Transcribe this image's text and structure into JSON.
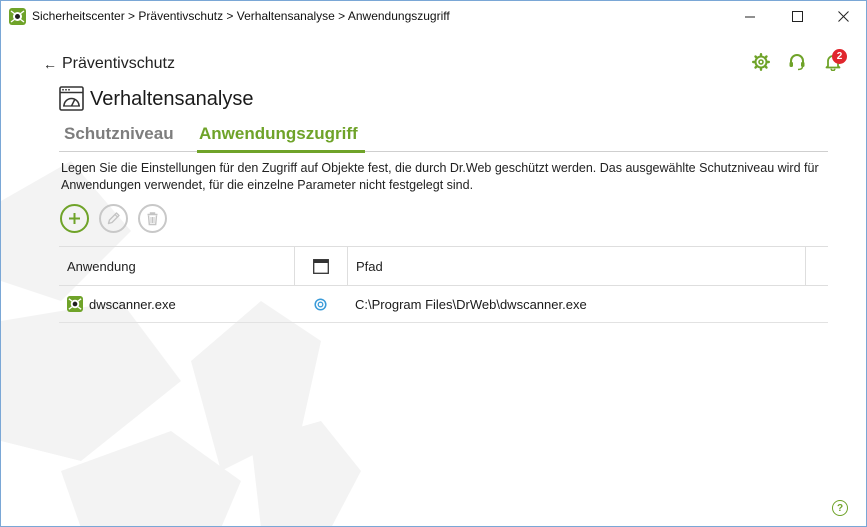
{
  "window": {
    "breadcrumb": "Sicherheitscenter > Präventivschutz > Verhaltensanalyse > Anwendungszugriff",
    "controls": {
      "minimize": "minimize-icon",
      "maximize": "maximize-icon",
      "close": "close-icon"
    }
  },
  "header": {
    "back_label": "Präventivschutz",
    "notification_count": "2",
    "icons": [
      "gear-icon",
      "headset-icon",
      "bell-icon"
    ]
  },
  "section": {
    "title": "Verhaltensanalyse"
  },
  "tabs": [
    {
      "label": "Schutzniveau",
      "active": false
    },
    {
      "label": "Anwendungszugriff",
      "active": true
    }
  ],
  "description": "Legen Sie die Einstellungen für den Zugriff auf Objekte fest, die durch Dr.Web geschützt werden. Das ausgewählte Schutzniveau wird für Anwendungen verwendet, für die einzelne Parameter nicht festgelegt sind.",
  "toolbar": {
    "add": "plus-icon",
    "edit": "pencil-icon",
    "delete": "trash-icon"
  },
  "table": {
    "columns": {
      "app": "Anwendung",
      "path": "Pfad"
    },
    "rows": [
      {
        "app": "dwscanner.exe",
        "path": "C:\\Program Files\\DrWeb\\dwscanner.exe"
      }
    ]
  },
  "colors": {
    "accent": "#6fa329",
    "badge": "#e0262d",
    "link_blue": "#3a9bd9"
  }
}
